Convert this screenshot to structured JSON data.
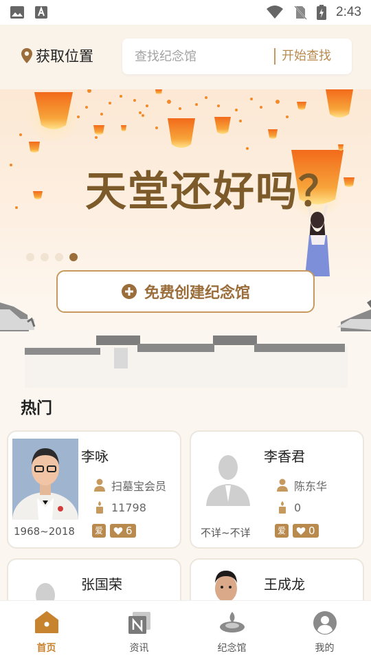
{
  "status_bar": {
    "time": "2:43"
  },
  "header": {
    "location_label": "获取位置",
    "search_placeholder": "查找纪念馆",
    "search_button": "开始查找"
  },
  "banner": {
    "title": "天堂还好吗？",
    "dots_count": 4,
    "active_dot": 3,
    "create_button": "免费创建纪念馆"
  },
  "hot": {
    "title": "热门",
    "cards": [
      {
        "name": "李咏",
        "creator": "扫墓宝会员",
        "candles": "11798",
        "dates": "1968~2018",
        "tag": "爱",
        "likes": "6"
      },
      {
        "name": "李香君",
        "creator": "陈东华",
        "candles": "0",
        "dates": "不详~不详",
        "tag": "爱",
        "likes": "0"
      },
      {
        "name": "张国荣"
      },
      {
        "name": "王成龙"
      }
    ]
  },
  "tabbar": {
    "tabs": [
      {
        "label": "首页",
        "icon": "home-icon"
      },
      {
        "label": "资讯",
        "icon": "news-icon"
      },
      {
        "label": "纪念馆",
        "icon": "memorial-icon"
      },
      {
        "label": "我的",
        "icon": "profile-icon"
      }
    ],
    "active_index": 0
  },
  "colors": {
    "accent": "#b88a4e",
    "accent_dark": "#9a6d3a",
    "tab_active": "#c8832f",
    "lantern": "#f27a1d"
  }
}
